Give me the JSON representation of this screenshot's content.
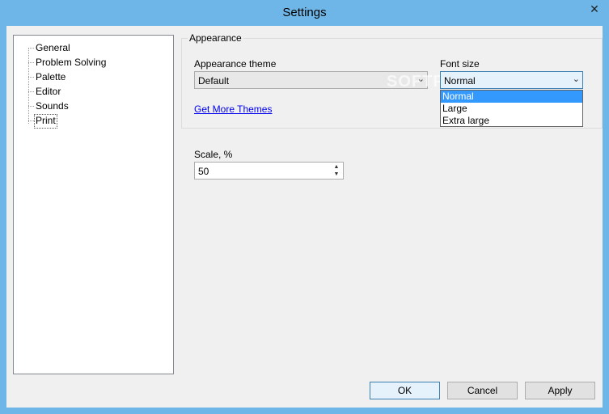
{
  "window": {
    "title": "Settings",
    "close_glyph": "✕"
  },
  "tree": {
    "items": [
      {
        "label": "General"
      },
      {
        "label": "Problem Solving"
      },
      {
        "label": "Palette"
      },
      {
        "label": "Editor"
      },
      {
        "label": "Sounds"
      },
      {
        "label": "Print",
        "selected": true
      }
    ]
  },
  "appearance": {
    "group_label": "Appearance",
    "theme_label": "Appearance theme",
    "theme_value": "Default",
    "font_size_label": "Font size",
    "font_size_value": "Normal",
    "font_size_options": [
      "Normal",
      "Large",
      "Extra large"
    ],
    "more_themes_link": "Get More Themes"
  },
  "scale": {
    "label": "Scale, %",
    "value": "50"
  },
  "buttons": {
    "ok": "OK",
    "cancel": "Cancel",
    "apply": "Apply"
  },
  "watermark": "SOFTPEDIA",
  "icons": {
    "chevron": "chevron-down-icon",
    "spinner": "spin-arrows-icon",
    "close": "close-icon"
  }
}
